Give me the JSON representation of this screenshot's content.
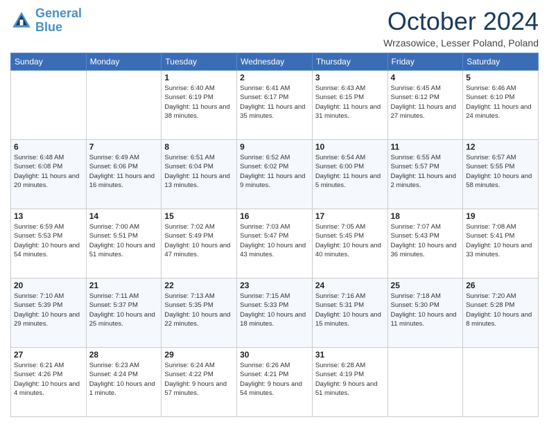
{
  "header": {
    "logo_line1": "General",
    "logo_line2": "Blue",
    "month_title": "October 2024",
    "location": "Wrzasowice, Lesser Poland, Poland"
  },
  "days_of_week": [
    "Sunday",
    "Monday",
    "Tuesday",
    "Wednesday",
    "Thursday",
    "Friday",
    "Saturday"
  ],
  "weeks": [
    [
      {
        "day": "",
        "details": ""
      },
      {
        "day": "",
        "details": ""
      },
      {
        "day": "1",
        "details": "Sunrise: 6:40 AM\nSunset: 6:19 PM\nDaylight: 11 hours and 38 minutes."
      },
      {
        "day": "2",
        "details": "Sunrise: 6:41 AM\nSunset: 6:17 PM\nDaylight: 11 hours and 35 minutes."
      },
      {
        "day": "3",
        "details": "Sunrise: 6:43 AM\nSunset: 6:15 PM\nDaylight: 11 hours and 31 minutes."
      },
      {
        "day": "4",
        "details": "Sunrise: 6:45 AM\nSunset: 6:12 PM\nDaylight: 11 hours and 27 minutes."
      },
      {
        "day": "5",
        "details": "Sunrise: 6:46 AM\nSunset: 6:10 PM\nDaylight: 11 hours and 24 minutes."
      }
    ],
    [
      {
        "day": "6",
        "details": "Sunrise: 6:48 AM\nSunset: 6:08 PM\nDaylight: 11 hours and 20 minutes."
      },
      {
        "day": "7",
        "details": "Sunrise: 6:49 AM\nSunset: 6:06 PM\nDaylight: 11 hours and 16 minutes."
      },
      {
        "day": "8",
        "details": "Sunrise: 6:51 AM\nSunset: 6:04 PM\nDaylight: 11 hours and 13 minutes."
      },
      {
        "day": "9",
        "details": "Sunrise: 6:52 AM\nSunset: 6:02 PM\nDaylight: 11 hours and 9 minutes."
      },
      {
        "day": "10",
        "details": "Sunrise: 6:54 AM\nSunset: 6:00 PM\nDaylight: 11 hours and 5 minutes."
      },
      {
        "day": "11",
        "details": "Sunrise: 6:55 AM\nSunset: 5:57 PM\nDaylight: 11 hours and 2 minutes."
      },
      {
        "day": "12",
        "details": "Sunrise: 6:57 AM\nSunset: 5:55 PM\nDaylight: 10 hours and 58 minutes."
      }
    ],
    [
      {
        "day": "13",
        "details": "Sunrise: 6:59 AM\nSunset: 5:53 PM\nDaylight: 10 hours and 54 minutes."
      },
      {
        "day": "14",
        "details": "Sunrise: 7:00 AM\nSunset: 5:51 PM\nDaylight: 10 hours and 51 minutes."
      },
      {
        "day": "15",
        "details": "Sunrise: 7:02 AM\nSunset: 5:49 PM\nDaylight: 10 hours and 47 minutes."
      },
      {
        "day": "16",
        "details": "Sunrise: 7:03 AM\nSunset: 5:47 PM\nDaylight: 10 hours and 43 minutes."
      },
      {
        "day": "17",
        "details": "Sunrise: 7:05 AM\nSunset: 5:45 PM\nDaylight: 10 hours and 40 minutes."
      },
      {
        "day": "18",
        "details": "Sunrise: 7:07 AM\nSunset: 5:43 PM\nDaylight: 10 hours and 36 minutes."
      },
      {
        "day": "19",
        "details": "Sunrise: 7:08 AM\nSunset: 5:41 PM\nDaylight: 10 hours and 33 minutes."
      }
    ],
    [
      {
        "day": "20",
        "details": "Sunrise: 7:10 AM\nSunset: 5:39 PM\nDaylight: 10 hours and 29 minutes."
      },
      {
        "day": "21",
        "details": "Sunrise: 7:11 AM\nSunset: 5:37 PM\nDaylight: 10 hours and 25 minutes."
      },
      {
        "day": "22",
        "details": "Sunrise: 7:13 AM\nSunset: 5:35 PM\nDaylight: 10 hours and 22 minutes."
      },
      {
        "day": "23",
        "details": "Sunrise: 7:15 AM\nSunset: 5:33 PM\nDaylight: 10 hours and 18 minutes."
      },
      {
        "day": "24",
        "details": "Sunrise: 7:16 AM\nSunset: 5:31 PM\nDaylight: 10 hours and 15 minutes."
      },
      {
        "day": "25",
        "details": "Sunrise: 7:18 AM\nSunset: 5:30 PM\nDaylight: 10 hours and 11 minutes."
      },
      {
        "day": "26",
        "details": "Sunrise: 7:20 AM\nSunset: 5:28 PM\nDaylight: 10 hours and 8 minutes."
      }
    ],
    [
      {
        "day": "27",
        "details": "Sunrise: 6:21 AM\nSunset: 4:26 PM\nDaylight: 10 hours and 4 minutes."
      },
      {
        "day": "28",
        "details": "Sunrise: 6:23 AM\nSunset: 4:24 PM\nDaylight: 10 hours and 1 minute."
      },
      {
        "day": "29",
        "details": "Sunrise: 6:24 AM\nSunset: 4:22 PM\nDaylight: 9 hours and 57 minutes."
      },
      {
        "day": "30",
        "details": "Sunrise: 6:26 AM\nSunset: 4:21 PM\nDaylight: 9 hours and 54 minutes."
      },
      {
        "day": "31",
        "details": "Sunrise: 6:28 AM\nSunset: 4:19 PM\nDaylight: 9 hours and 51 minutes."
      },
      {
        "day": "",
        "details": ""
      },
      {
        "day": "",
        "details": ""
      }
    ]
  ]
}
